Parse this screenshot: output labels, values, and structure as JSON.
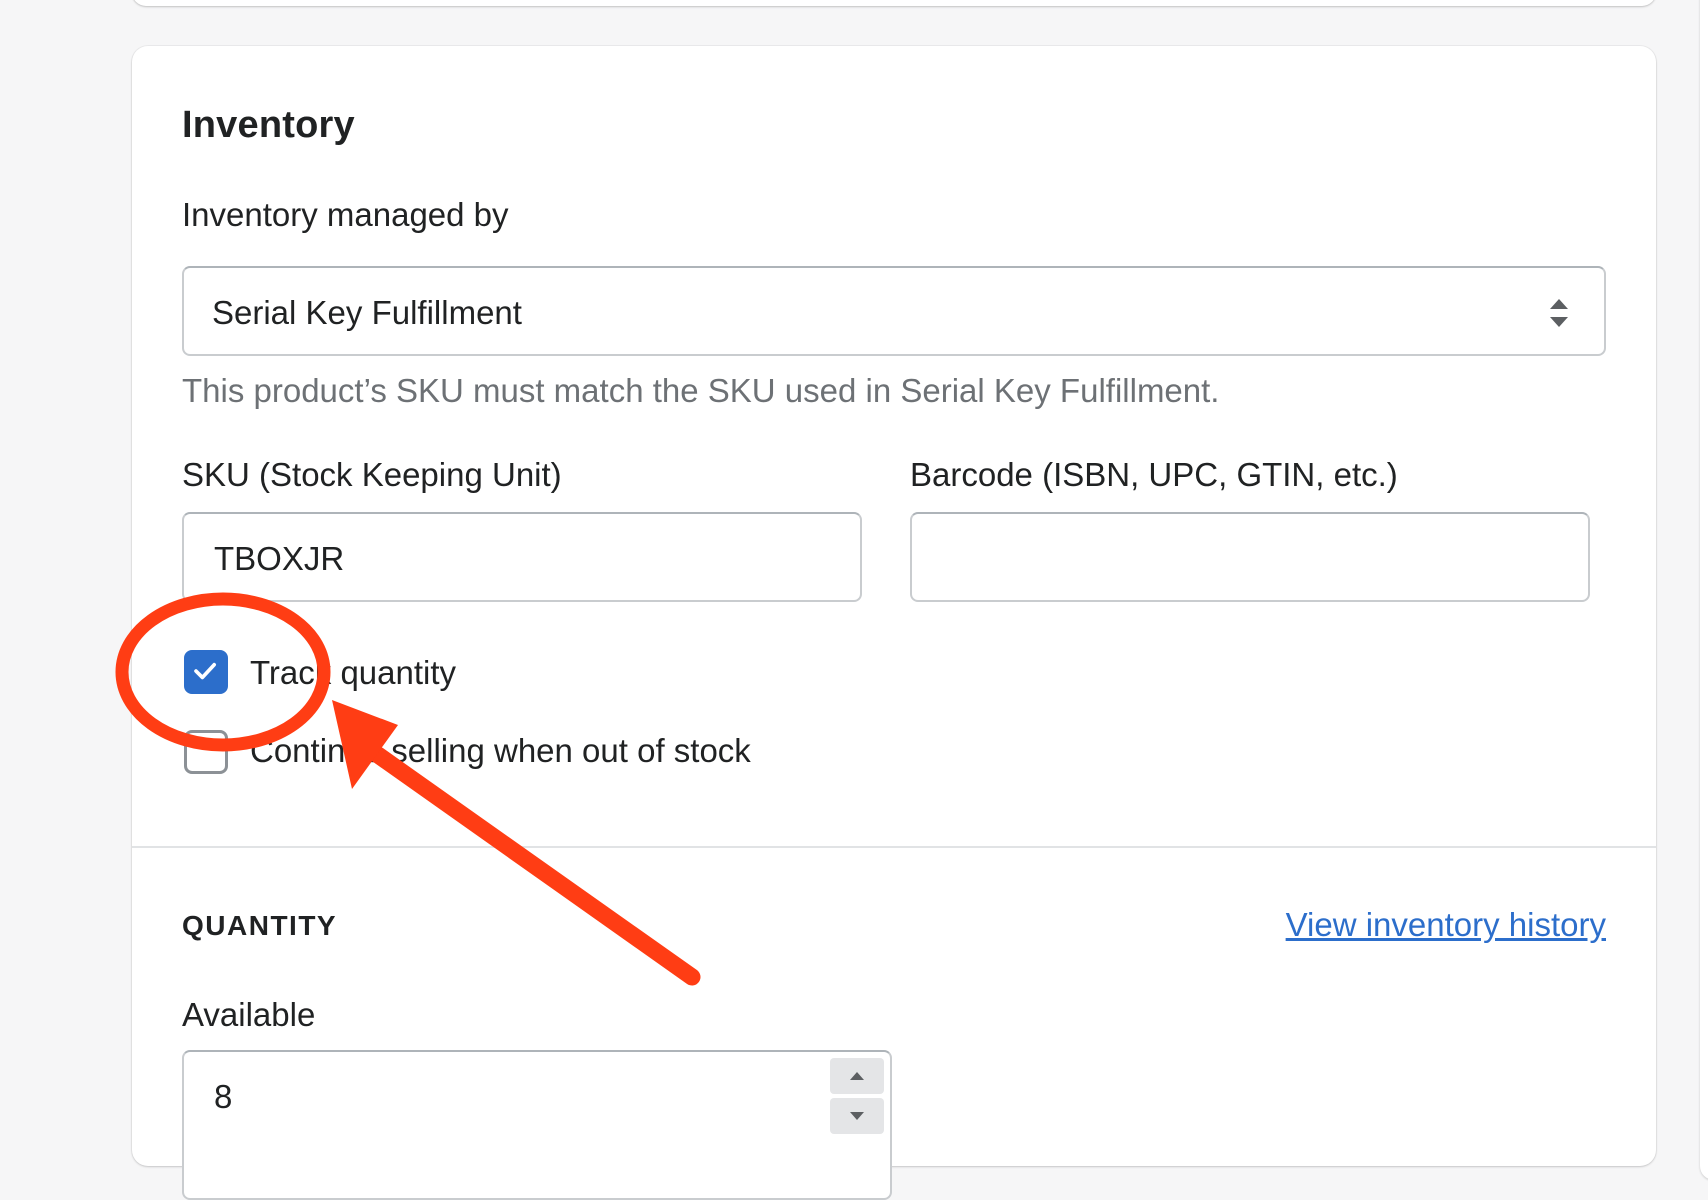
{
  "inventory": {
    "title": "Inventory",
    "managed_by_label": "Inventory managed by",
    "managed_by_value": "Serial Key Fulfillment",
    "help_text": "This product’s SKU must match the SKU used in Serial Key Fulfillment.",
    "sku_label": "SKU (Stock Keeping Unit)",
    "sku_value": "TBOXJR",
    "barcode_label": "Barcode (ISBN, UPC, GTIN, etc.)",
    "barcode_value": "",
    "track_quantity_label": "Track quantity",
    "track_quantity_checked": true,
    "continue_selling_label": "Continue selling when out of stock",
    "continue_selling_checked": false
  },
  "quantity": {
    "heading": "QUANTITY",
    "history_link": "View inventory history",
    "available_label": "Available",
    "available_value": "8"
  },
  "colors": {
    "accent": "#2c6ecb",
    "annotation": "#ff3d14"
  },
  "icons": {
    "select_arrows": "up-down-chevron-icon",
    "checkmark": "checkmark-icon",
    "stepper_up": "triangle-up-icon",
    "stepper_down": "triangle-down-icon"
  }
}
